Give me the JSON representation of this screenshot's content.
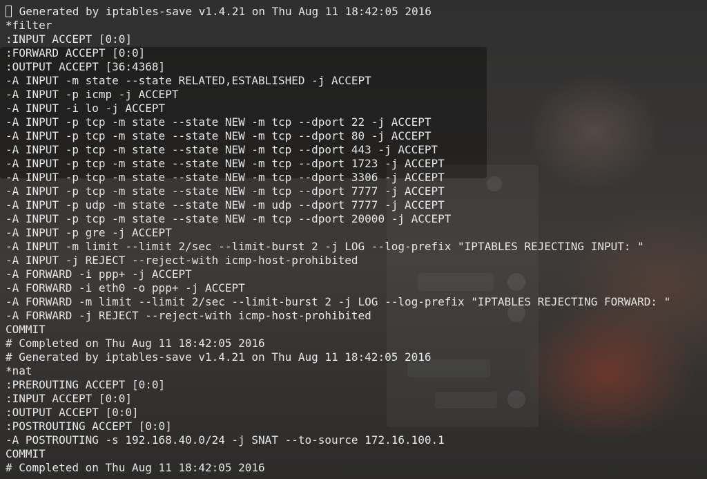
{
  "terminal": {
    "lines": [
      "# Generated by iptables-save v1.4.21 on Thu Aug 11 18:42:05 2016",
      "*filter",
      ":INPUT ACCEPT [0:0]",
      ":FORWARD ACCEPT [0:0]",
      ":OUTPUT ACCEPT [36:4368]",
      "-A INPUT -m state --state RELATED,ESTABLISHED -j ACCEPT",
      "-A INPUT -p icmp -j ACCEPT",
      "-A INPUT -i lo -j ACCEPT",
      "-A INPUT -p tcp -m state --state NEW -m tcp --dport 22 -j ACCEPT",
      "-A INPUT -p tcp -m state --state NEW -m tcp --dport 80 -j ACCEPT",
      "-A INPUT -p tcp -m state --state NEW -m tcp --dport 443 -j ACCEPT",
      "-A INPUT -p tcp -m state --state NEW -m tcp --dport 1723 -j ACCEPT",
      "-A INPUT -p tcp -m state --state NEW -m tcp --dport 3306 -j ACCEPT",
      "-A INPUT -p tcp -m state --state NEW -m tcp --dport 7777 -j ACCEPT",
      "-A INPUT -p udp -m state --state NEW -m udp --dport 7777 -j ACCEPT",
      "-A INPUT -p tcp -m state --state NEW -m tcp --dport 20000 -j ACCEPT",
      "-A INPUT -p gre -j ACCEPT",
      "-A INPUT -m limit --limit 2/sec --limit-burst 2 -j LOG --log-prefix \"IPTABLES REJECTING INPUT: \"",
      "-A INPUT -j REJECT --reject-with icmp-host-prohibited",
      "-A FORWARD -i ppp+ -j ACCEPT",
      "-A FORWARD -i eth0 -o ppp+ -j ACCEPT",
      "-A FORWARD -m limit --limit 2/sec --limit-burst 2 -j LOG --log-prefix \"IPTABLES REJECTING FORWARD: \"",
      "-A FORWARD -j REJECT --reject-with icmp-host-prohibited",
      "COMMIT",
      "# Completed on Thu Aug 11 18:42:05 2016",
      "# Generated by iptables-save v1.4.21 on Thu Aug 11 18:42:05 2016",
      "*nat",
      ":PREROUTING ACCEPT [0:0]",
      ":INPUT ACCEPT [0:0]",
      ":OUTPUT ACCEPT [0:0]",
      ":POSTROUTING ACCEPT [0:0]",
      "-A POSTROUTING -s 192.168.40.0/24 -j SNAT --to-source 172.16.100.1",
      "COMMIT",
      "# Completed on Thu Aug 11 18:42:05 2016"
    ]
  },
  "colors": {
    "text": "#e6e6e6",
    "background": "#2f2f2f"
  },
  "icons": {
    "cursor": "block-cursor-icon"
  }
}
